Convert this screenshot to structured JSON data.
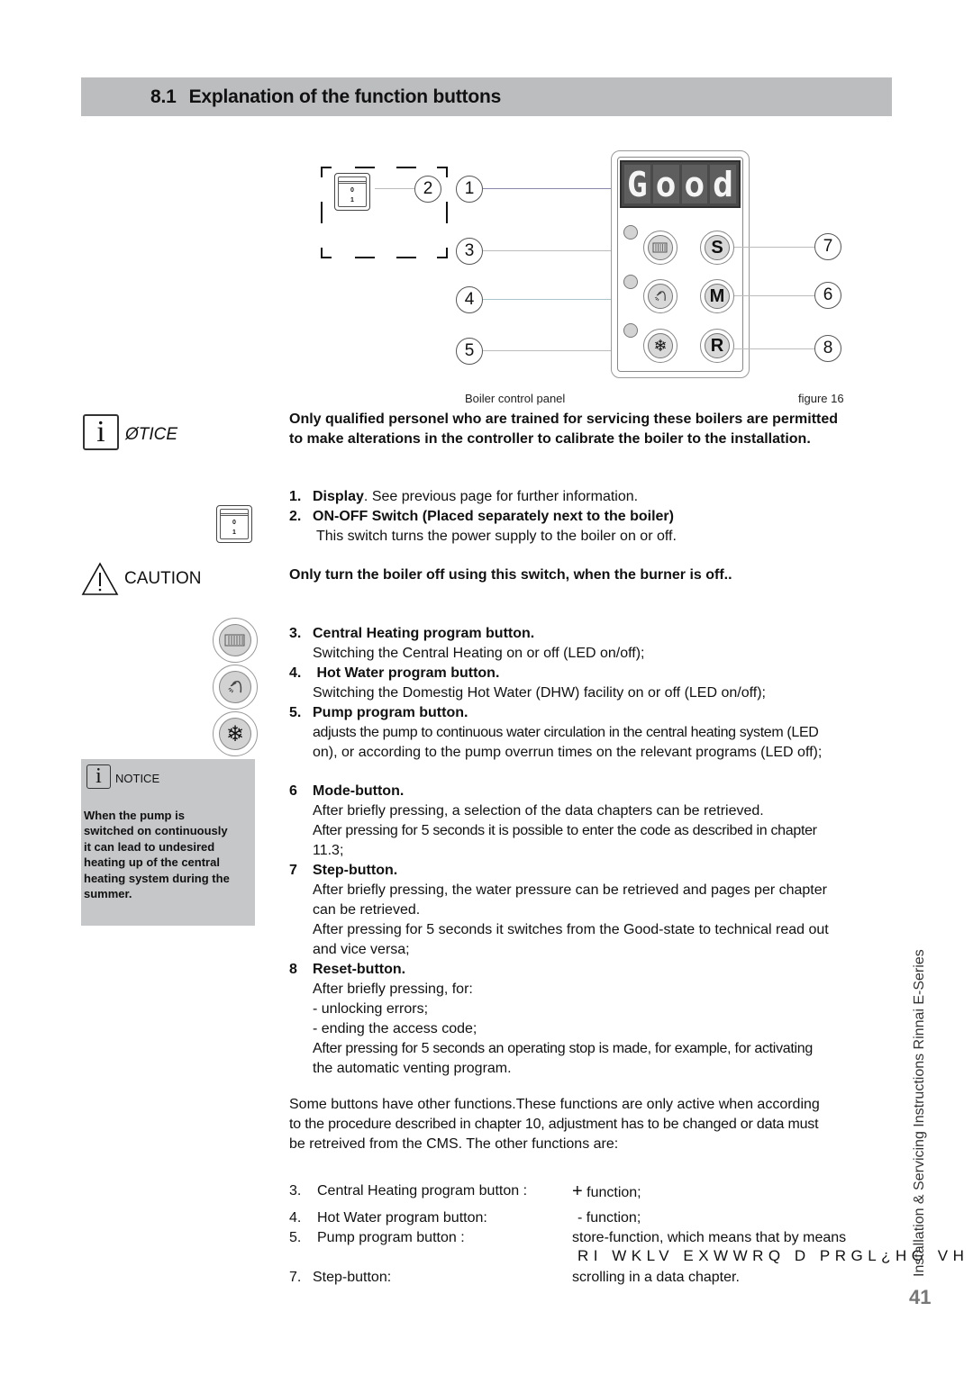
{
  "section": {
    "number": "8.1",
    "title": "Explanation of the function buttons"
  },
  "figure": {
    "display_text": [
      "G",
      "o",
      "o",
      "d"
    ],
    "callouts": [
      "1",
      "2",
      "3",
      "4",
      "5",
      "6",
      "7",
      "8"
    ],
    "switch_labels": {
      "top": "0",
      "bottom": "1"
    },
    "button_letters": {
      "step": "S",
      "mode": "M",
      "reset": "R"
    },
    "caption": "Boiler control panel",
    "figure_label": "figure 16"
  },
  "notice_main": {
    "label": "NOTICE",
    "label_rendered": "ØTICE",
    "icon": "info-icon",
    "text_lines": [
      "Only qualified personel who are trained for servicing these boilers are permitted",
      "to make alterations in the controller to calibrate the boiler to the installation."
    ]
  },
  "items_top": [
    {
      "num": "1.",
      "title": "Display",
      "rest": ". See previous page for further information."
    },
    {
      "num": "2.",
      "title": "ON-OFF Switch (Placed separately next to the boiler)",
      "desc": "This switch turns the power supply to the boiler on or off."
    }
  ],
  "caution": {
    "label": "CAUTION",
    "icon": "warning-triangle-icon",
    "text": "Only turn the boiler off using this switch, when the burner is off.."
  },
  "items_program": [
    {
      "num": "3.",
      "title": "Central Heating program button.",
      "desc": [
        "Switching the Central Heating on or off  (LED on/off);"
      ]
    },
    {
      "num": "4.",
      "title": " Hot Water program button.",
      "desc": [
        "Switching the Domestig Hot Water (DHW) facility on or off  (LED on/off);"
      ]
    },
    {
      "num": "5.",
      "title": "Pump program button.",
      "desc": [
        "adjusts the pump to continuous water circulation in the central heating system (LED",
        "on), or according to the pump overrun times on the relevant programs (LED off);"
      ]
    }
  ],
  "notice_side": {
    "label": "NOTICE",
    "text_lines": [
      "When the pump is",
      "switched on continuously",
      "it can lead to undesired",
      "heating up of the central",
      "heating system during the",
      "summer."
    ]
  },
  "items_mode": [
    {
      "num": "6",
      "title": "Mode-button.",
      "desc": [
        "After briefly pressing, a selection of the data chapters can be retrieved.",
        "After pressing for 5 seconds it is possible to enter the code as described in chapter",
        "11.3;"
      ]
    },
    {
      "num": "7",
      "title": "Step-button.",
      "desc": [
        "After briefly pressing, the water pressure can be retrieved and pages per chapter",
        "can be retrieved.",
        "After pressing for 5 seconds it switches from the Good-state to technical read out",
        "and vice versa;"
      ]
    },
    {
      "num": "8",
      "title": "Reset-button.",
      "desc": [
        "After briefly pressing, for:",
        "- unlocking errors;",
        "- ending the access code;",
        "After pressing for 5 seconds an operating stop is made, for example, for activating",
        "the automatic venting program."
      ]
    }
  ],
  "other_intro": [
    "Some buttons have other functions.These functions are only active when according",
    "to the procedure described in chapter 10, adjustment has to be changed or data must",
    "be retreived from the CMS. The other functions are:"
  ],
  "other_functions": [
    {
      "num": "3.",
      "button": "Central Heating program button :",
      "symbol": "+",
      "function": " function;"
    },
    {
      "num": "4.",
      "button": "Hot Water program button:",
      "symbol": "-",
      "function": " function;"
    },
    {
      "num": "5.",
      "button": "Pump program button :",
      "symbol": "",
      "function": "store-function, which means that by means",
      "function_line2": "RI WKLV  EXWWRQ D PRGL¿HG VH"
    },
    {
      "num": "7.",
      "button": "Step-button:",
      "symbol": "",
      "function": "scrolling in a data chapter."
    }
  ],
  "footer": {
    "vertical_title": "Installation & Servicing Instructions Rinnai E-Series",
    "page_number": "41"
  }
}
